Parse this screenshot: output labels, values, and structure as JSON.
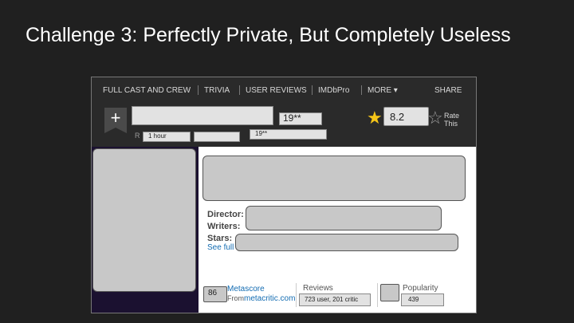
{
  "slide": {
    "title": "Challenge 3: Perfectly Private, But Completely Useless"
  },
  "nav": {
    "items": [
      "FULL CAST AND CREW",
      "TRIVIA",
      "USER REVIEWS",
      "IMDbPro",
      "MORE ▾"
    ],
    "share": "SHARE"
  },
  "hero": {
    "add_glyph": "+",
    "year_box": "19**",
    "rating_letter": "R",
    "runtime_box": "1 hour",
    "release_box": "19**",
    "rating_value": "8.2",
    "rate_line1": "Rate",
    "rate_line2": "This"
  },
  "credits": {
    "director_label": "Director:",
    "writers_label": "Writers:",
    "stars_label": "Stars:",
    "see_full": "See full"
  },
  "footer": {
    "metascore_box": "86",
    "metascore_label": "Metascore",
    "from_text": "From",
    "metacritic_link": "metacritic.com",
    "reviews_label": "Reviews",
    "reviews_box": "723 user, 201 critic",
    "popularity_label": "Popularity",
    "popularity_box": "439"
  },
  "colors": {
    "background": "#202020",
    "nav_bg": "#2a2a2a",
    "star": "#f5c518",
    "link": "#136cb2"
  }
}
